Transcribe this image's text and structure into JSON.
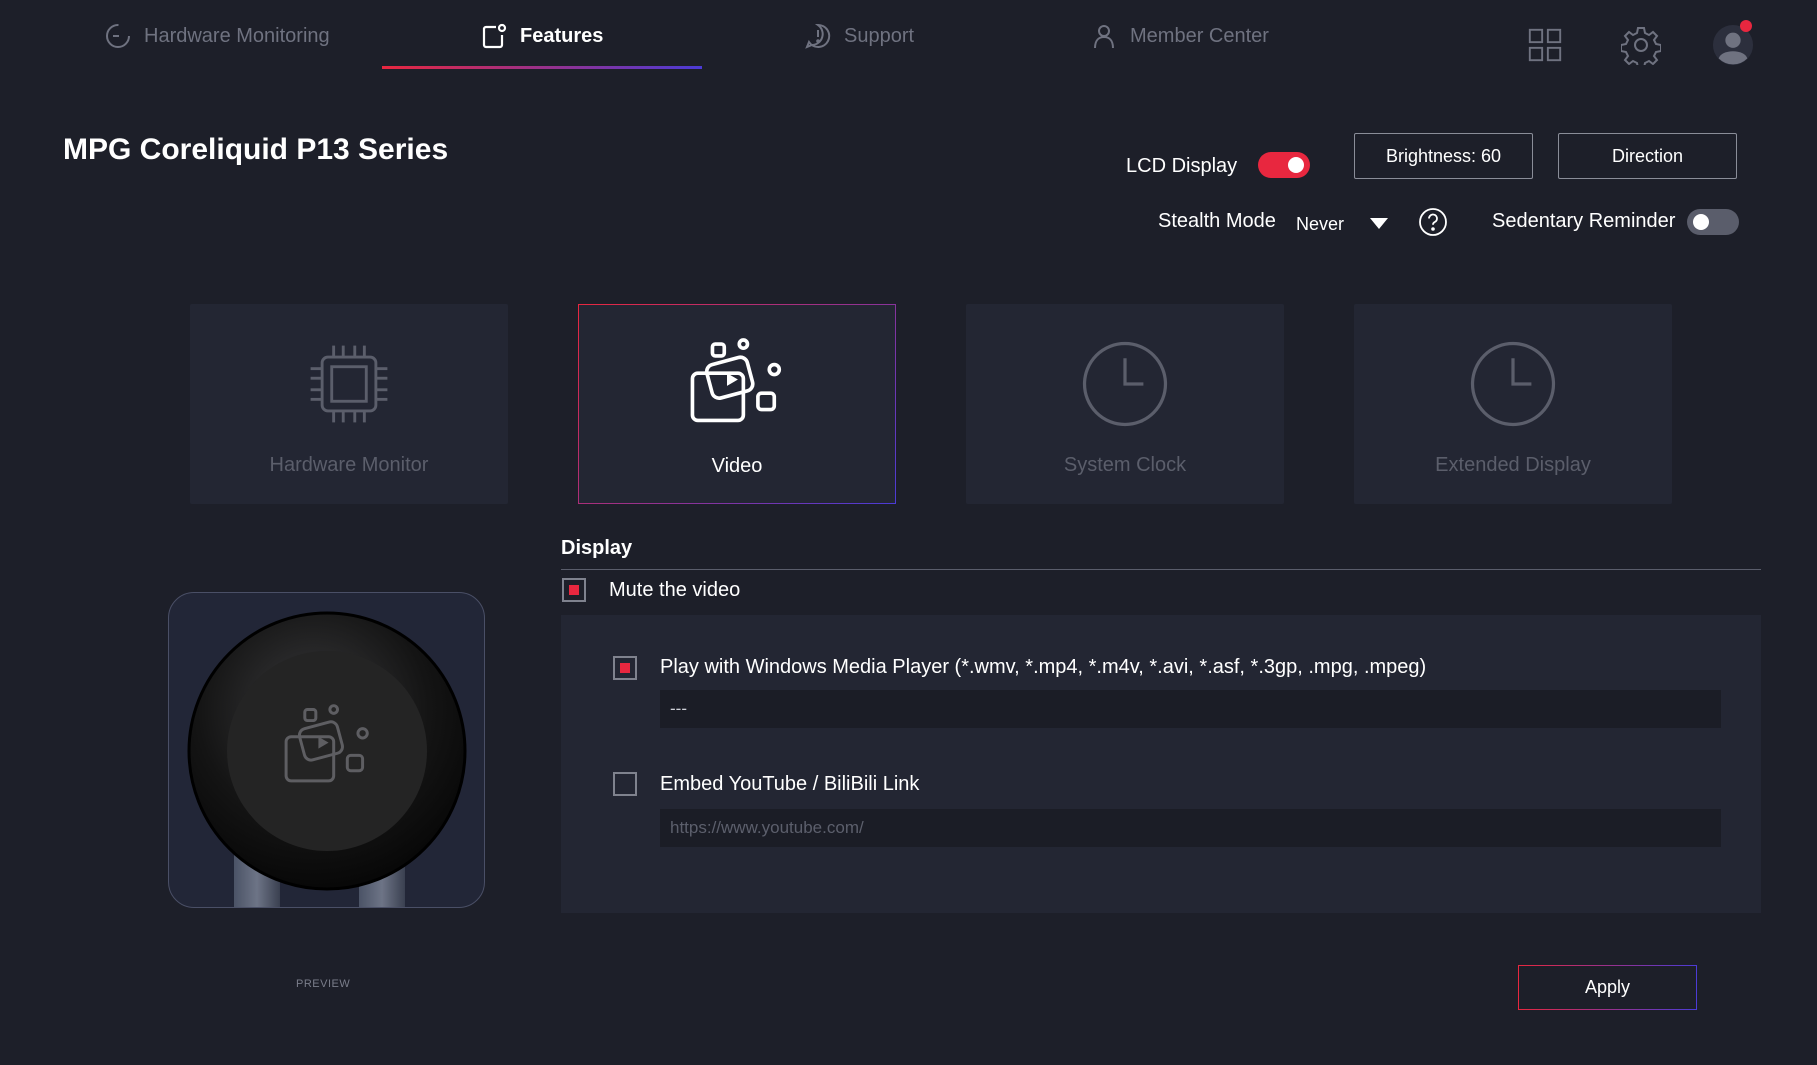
{
  "nav": {
    "tabs": [
      {
        "label": "Hardware Monitoring",
        "icon": "gauge-icon"
      },
      {
        "label": "Features",
        "icon": "features-icon"
      },
      {
        "label": "Support",
        "icon": "support-icon"
      },
      {
        "label": "Member Center",
        "icon": "user-icon"
      }
    ],
    "active_tab": "Features",
    "right_icons": [
      "grid-icon",
      "gear-icon",
      "avatar-icon"
    ]
  },
  "header": {
    "title": "MPG Coreliquid P13 Series",
    "lcd_display_label": "LCD Display",
    "lcd_display_on": true,
    "brightness_label": "Brightness: 60",
    "direction_label": "Direction",
    "stealth_mode_label": "Stealth Mode",
    "stealth_mode_value": "Never",
    "sedentary_reminder_label": "Sedentary Reminder",
    "sedentary_reminder_on": false
  },
  "modes": [
    {
      "label": "Hardware Monitor",
      "icon": "cpu-chip-icon",
      "active": false
    },
    {
      "label": "Video",
      "icon": "video-icon",
      "active": true
    },
    {
      "label": "System Clock",
      "icon": "clock-icon",
      "active": false
    },
    {
      "label": "Extended Display",
      "icon": "clock-icon",
      "active": false
    }
  ],
  "preview": {
    "label": "PREVIEW"
  },
  "display": {
    "section_title": "Display",
    "mute_label": "Mute the video",
    "mute_checked": true,
    "wmp_label": "Play with Windows Media Player (*.wmv, *.mp4, *.m4v, *.avi, *.asf, *.3gp, .mpg, .mpeg)",
    "wmp_checked": true,
    "wmp_value": "---",
    "youtube_label": "Embed YouTube / BiliBili Link",
    "youtube_checked": false,
    "youtube_placeholder": "https://www.youtube.com/"
  },
  "apply_label": "Apply",
  "colors": {
    "accent_red": "#e8273f",
    "accent_blue": "#4b3bd6",
    "background": "#1d1f29",
    "card": "#232633"
  }
}
